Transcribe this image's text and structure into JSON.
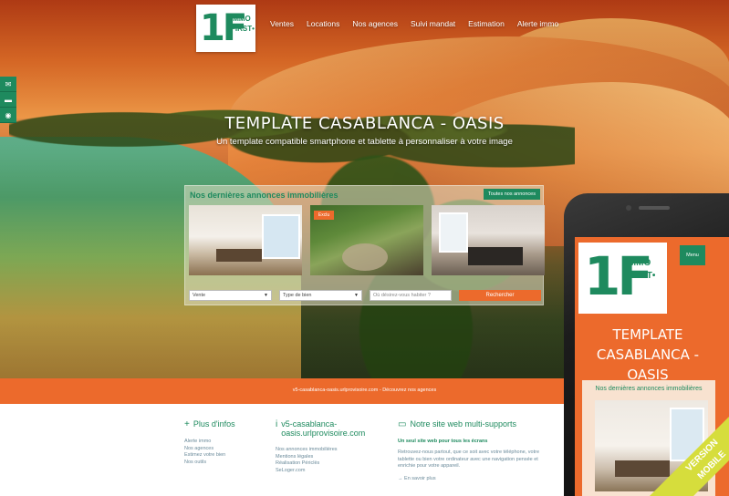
{
  "header": {
    "logo_mark": "1F",
    "logo_line1": "IMMO",
    "logo_line2": "FIRST•"
  },
  "nav": {
    "items": [
      "Ventes",
      "Locations",
      "Nos agences",
      "Suivi mandat",
      "Estimation",
      "Alerte immo"
    ]
  },
  "side_icons": [
    "mail-icon",
    "cart-icon",
    "rss-icon"
  ],
  "hero": {
    "title": "TEMPLATE CASABLANCA - OASIS",
    "subtitle": "Un template compatible smartphone et tablette à personnaliser à votre image"
  },
  "listings": {
    "title": "Nos dernières annonces immobilières",
    "all_button": "Toutes nos annonces",
    "badge": "Exclu",
    "search": {
      "type_value": "Vente",
      "property_value": "Type de bien",
      "location_placeholder": "Où désirez-vous habiter ?",
      "button": "Rechercher"
    }
  },
  "band": {
    "text": "v5-casablanca-oasis.urlprovisoire.com - Découvrez nos agences"
  },
  "footer": {
    "col1": {
      "title": "Plus d'infos",
      "links": [
        "Alerte immo",
        "Nos agences",
        "Estimez votre bien",
        "Nos outils"
      ]
    },
    "col2": {
      "title": "v5-casablanca-oasis.urlprovisoire.com",
      "links": [
        "Nos annonces immobilières",
        "Mentions légales",
        "Réalisation Périclès",
        "SeLoger.com"
      ]
    },
    "col3": {
      "title": "Notre site web multi-supports",
      "lead": "Un seul site web pour tous les écrans",
      "body": "Retrouvez-nous partout, que ce soit avec votre téléphone, votre tablette ou bien votre ordinateur avec une navigation pensée et enrichie pour votre appareil.",
      "more": "En savoir plus"
    }
  },
  "phone": {
    "logo_mark": "1F",
    "logo_line1": "IMMO",
    "logo_line2": "FIRST•",
    "menu": "Menu",
    "title": "TEMPLATE CASABLANCA - OASIS",
    "listings_title": "Nos dernières annonces immobilières"
  },
  "ribbon": {
    "line1": "VERSION",
    "line2": "MOBILE"
  },
  "colors": {
    "brand_green": "#1e8a5e",
    "accent_orange": "#ec6a2c",
    "ribbon_yellow": "#d6dd3c"
  }
}
